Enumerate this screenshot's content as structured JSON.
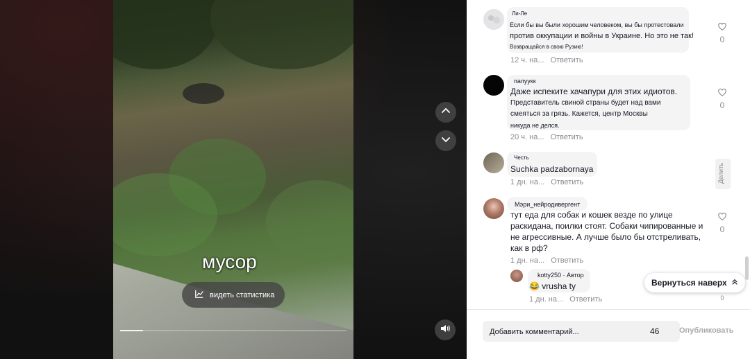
{
  "video": {
    "caption": "мусор",
    "stats_label": "видеть статистика",
    "progress": 0.1
  },
  "comments": [
    {
      "username": "Ли-Ле",
      "lines": [
        "Если бы вы были хорошим человеком, вы бы протестовали",
        "против оккупации и войны в Украине. Но это не так!",
        "Возвращайся в свою Рузию!"
      ],
      "time": "12 ч. на...",
      "reply": "Ответить",
      "likes": "0"
    },
    {
      "username": "папуукк",
      "lines": [
        "Даже испеките хачапури для этих идиотов.",
        "Представитель свиной страны будет над вами",
        "смеяться за грязь. Кажется, центр Москвы",
        "никуда не делся."
      ],
      "time": "20 ч. на...",
      "reply": "Ответить",
      "likes": "0"
    },
    {
      "username": "Честь",
      "lines": [
        "Suchka padzabornaya"
      ],
      "time": "1 дн. на...",
      "reply": "Ответить",
      "side_action": "Делить"
    },
    {
      "username": "Мэри_нейродивергент",
      "lines": [
        "тут еда для собак и кошек везде по улице",
        "раскидана, поилки стоят. Собаки чипированные и",
        "не агрессивные. А лучше было бы отстреливать,",
        "как в рф?"
      ],
      "time": "1 дн. на...",
      "reply": "Ответить",
      "likes": "0"
    }
  ],
  "reply": {
    "username": "kotty250",
    "author_badge": "· Автор",
    "emoji": "😂",
    "text": "vrusha ty",
    "time": "1 дн. на...",
    "reply": "Ответить",
    "likes": "0"
  },
  "back_to_top": "Вернуться наверх",
  "comment_bar": {
    "placeholder": "Добавить комментарий...",
    "char_count": "46",
    "publish_label": "Опубликовать"
  }
}
